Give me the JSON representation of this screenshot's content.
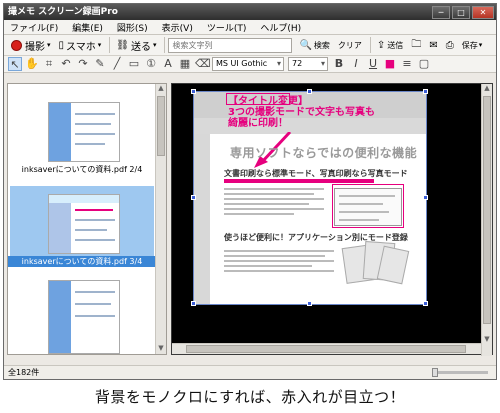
{
  "window": {
    "title": "撮メモ スクリーン録画Pro",
    "controls": [
      "─",
      "□",
      "✕"
    ]
  },
  "menu": [
    "ファイル(F)",
    "編集(E)",
    "図形(S)",
    "表示(V)",
    "ツール(T)",
    "ヘルプ(H)"
  ],
  "toolbar": {
    "capture_label": "撮影",
    "smartphone_label": "スマホ",
    "send_label": "送る",
    "search_placeholder": "検索文字列",
    "search_button": "検索",
    "clear_button": "クリア",
    "transmit_label": "送信",
    "save_label": "保存"
  },
  "format_bar": {
    "font_name": "MS UI Gothic",
    "font_size": "72",
    "bold_label": "B",
    "italic_label": "I",
    "underline_label": "U"
  },
  "thumbnails": [
    {
      "caption": "inksaverについての資料.pdf 2/4",
      "selected": false
    },
    {
      "caption": "inksaverについての資料.pdf 3/4",
      "selected": true
    },
    {
      "caption": "",
      "selected": false
    }
  ],
  "document": {
    "annotation_line1": "【タイトル変更】",
    "annotation_line2": "3つの撮影モードで文字も写真も",
    "annotation_line3": "綺麗に印刷！",
    "heading": "専用ソフトならではの便利な機能",
    "bullet1": "文書印刷なら標準モード、写真印刷なら写真モード",
    "bullet2": "使うほど便利に！アプリケーション別にモード登録"
  },
  "status": {
    "count": "全182件"
  },
  "caption": "背景をモノクロにすれば、赤入れが目立つ！",
  "colors": {
    "accent_pink": "#e6007e",
    "record_red": "#d8211b",
    "selection_blue": "#3a86d6"
  }
}
